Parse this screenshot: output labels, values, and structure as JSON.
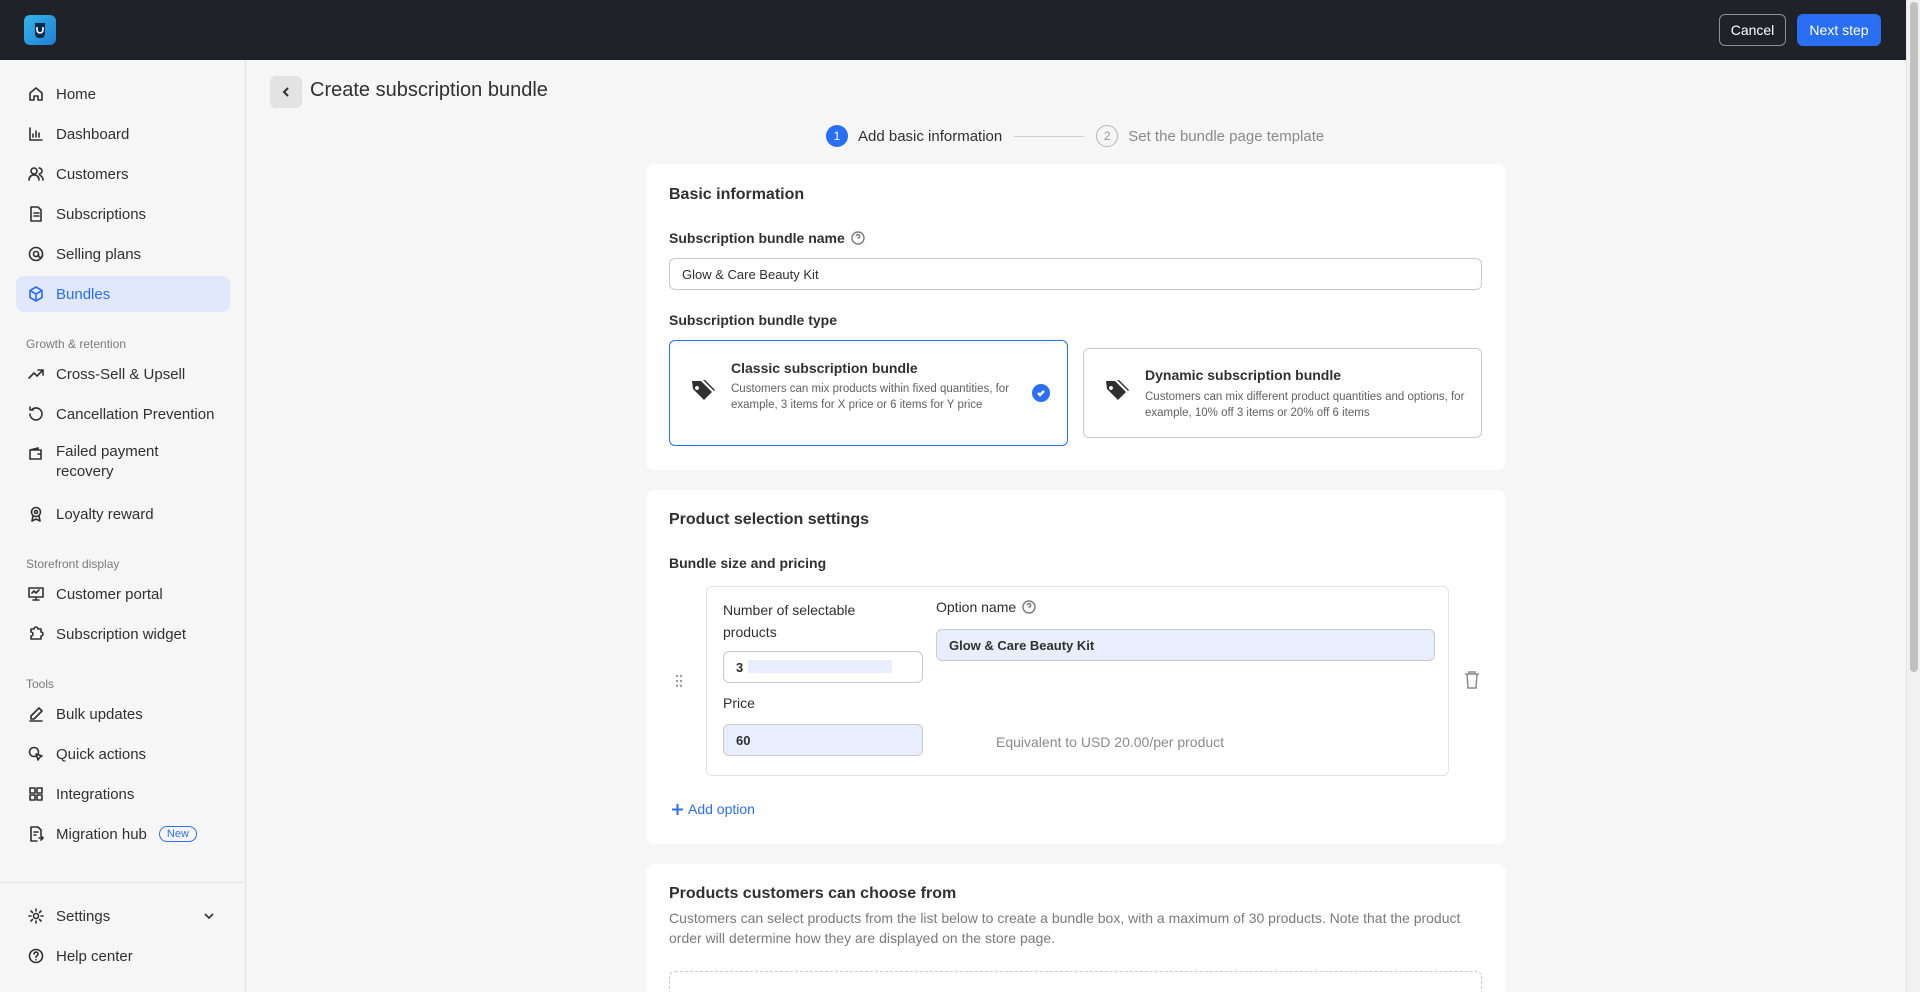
{
  "topbar": {
    "cancel_label": "Cancel",
    "next_label": "Next step"
  },
  "sidebar": {
    "main_items": [
      {
        "label": "Home",
        "icon": "home-icon"
      },
      {
        "label": "Dashboard",
        "icon": "bar-chart-icon"
      },
      {
        "label": "Customers",
        "icon": "users-icon"
      },
      {
        "label": "Subscriptions",
        "icon": "document-icon"
      },
      {
        "label": "Selling plans",
        "icon": "at-icon"
      },
      {
        "label": "Bundles",
        "icon": "cube-icon",
        "active": true
      }
    ],
    "growth_section": "Growth & retention",
    "growth_items": [
      {
        "label": "Cross-Sell & Upsell",
        "icon": "trend-up-icon"
      },
      {
        "label": "Cancellation Prevention",
        "icon": "refresh-icon"
      },
      {
        "label": "Failed payment recovery",
        "icon": "wallet-icon"
      },
      {
        "label": "Loyalty reward",
        "icon": "award-icon"
      }
    ],
    "storefront_section": "Storefront display",
    "storefront_items": [
      {
        "label": "Customer portal",
        "icon": "monitor-icon"
      },
      {
        "label": "Subscription widget",
        "icon": "puzzle-icon"
      }
    ],
    "tools_section": "Tools",
    "tools_items": [
      {
        "label": "Bulk updates",
        "icon": "pencil-icon"
      },
      {
        "label": "Quick actions",
        "icon": "cursor-icon"
      },
      {
        "label": "Integrations",
        "icon": "grid-icon"
      },
      {
        "label": "Migration hub",
        "icon": "migrate-icon",
        "badge": "New"
      }
    ],
    "bottom_items": [
      {
        "label": "Settings",
        "icon": "gear-icon"
      },
      {
        "label": "Help center",
        "icon": "help-circle-icon"
      }
    ]
  },
  "page": {
    "title": "Create subscription bundle"
  },
  "steps": [
    {
      "number": "1",
      "label": "Add basic information",
      "active": true
    },
    {
      "number": "2",
      "label": "Set the bundle page template",
      "active": false
    }
  ],
  "basic_info": {
    "title": "Basic information",
    "name_label": "Subscription bundle name",
    "name_value": "Glow & Care Beauty Kit",
    "type_label": "Subscription bundle type",
    "classic": {
      "title": "Classic subscription bundle",
      "desc": "Customers can mix products within fixed quantities, for example, 3 items for X price or 6 items for Y price",
      "selected": true
    },
    "dynamic": {
      "title": "Dynamic subscription bundle",
      "desc": "Customers can mix different product quantities and options, for example, 10% off 3 items or 20% off 6 items",
      "selected": false
    }
  },
  "product_selection": {
    "title": "Product selection settings",
    "size_label": "Bundle size and pricing",
    "option": {
      "num_label": "Number of selectable products",
      "num_value": "3",
      "option_name_label": "Option name",
      "option_name_value": "Glow & Care Beauty Kit",
      "price_label": "Price",
      "price_value": "60",
      "equiv": "Equivalent to USD 20.00/per product"
    },
    "add_option_label": "Add option"
  },
  "products_choose": {
    "title": "Products customers can choose from",
    "desc": "Customers can select products from the list below to create a bundle box, with a maximum of 30 products. Note that the product order will determine how they are displayed on the store page."
  },
  "colors": {
    "accent": "#2a6ff3",
    "topbar": "#1f2329",
    "active_bg": "#e1e8fb"
  }
}
